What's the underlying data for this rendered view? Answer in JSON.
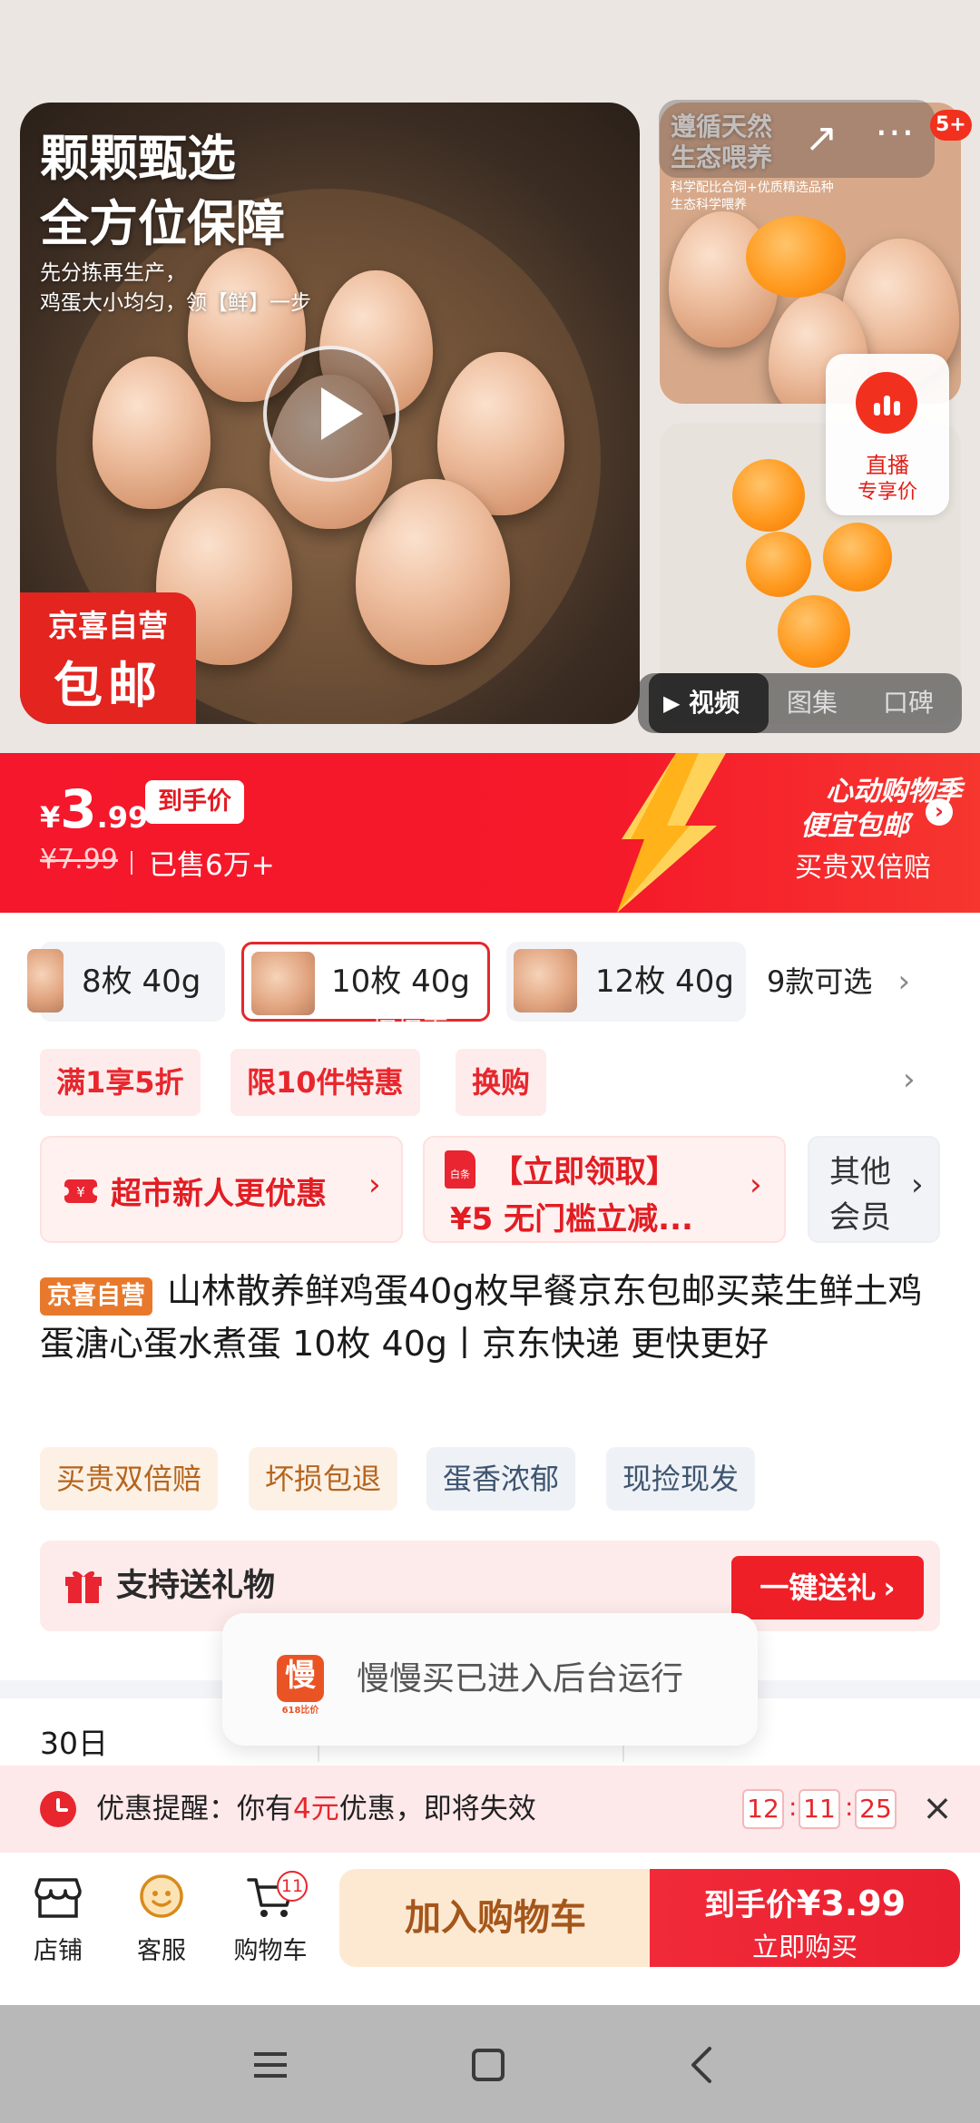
{
  "gallery": {
    "main_title": "颗颗甄选\n全方位保障",
    "main_subtitle": "先分拣再生产，\n鸡蛋大小均匀，领【鲜】一步",
    "badge_line1": "京喜自营",
    "badge_line2": "包邮",
    "side1_title": "遵循天然\n生态喂养",
    "side1_sub": "科学配比合饲+优质精选品种\n生态科学喂养",
    "message_badge": "5+",
    "live_label": "直播",
    "live_sub": "专享价",
    "tabs": [
      {
        "label": "视频",
        "active": true
      },
      {
        "label": "图集",
        "active": false
      },
      {
        "label": "口碑",
        "active": false
      }
    ]
  },
  "price": {
    "currency": "¥",
    "integer": "3",
    "decimal": ".99",
    "tag": "到手价",
    "original": "¥7.99",
    "sold": "已售6万+",
    "promo_line1": "心动购物季",
    "promo_line2": "便宜包邮",
    "promo_line3": "买贵双倍赔",
    "accent_color": "#f5172b"
  },
  "variants": {
    "items": [
      {
        "label": "8枚 40g",
        "selected": false
      },
      {
        "label": "10枚 40g",
        "selected": true
      },
      {
        "label": "12枚 40g",
        "selected": false
      }
    ],
    "count_label": "9款可选",
    "watermark": "慢慢买"
  },
  "coupons": [
    "满1享5折",
    "限10件特惠",
    "换购"
  ],
  "benefits": {
    "new_user": "超市新人更优惠",
    "coupon_icon": "白条",
    "coupon_line1": "【立即领取】",
    "coupon_line2": "¥5 无门槛立减...",
    "member_line1": "其他",
    "member_line2": "会员"
  },
  "product": {
    "tag": "京喜自营",
    "title": "山林散养鲜鸡蛋40g枚早餐京东包邮买菜生鲜土鸡蛋溏心蛋水煮蛋 10枚 40g丨京东快递 更快更好",
    "services": [
      {
        "label": "买贵双倍赔",
        "style": "warm"
      },
      {
        "label": "坏损包退",
        "style": "warm"
      },
      {
        "label": "蛋香浓郁",
        "style": "cool"
      },
      {
        "label": "现捡现发",
        "style": "cool"
      }
    ]
  },
  "gift": {
    "label": "支持送礼物",
    "button": "一键送礼"
  },
  "toast": {
    "icon_char": "慢",
    "icon_sub": "618比价",
    "message": "慢慢买已进入后台运行"
  },
  "params": {
    "first": "30日"
  },
  "reminder": {
    "prefix": "优惠提醒：你有",
    "amount": "4元",
    "suffix": "优惠，即将失效",
    "hours": "12",
    "minutes": "11",
    "seconds": "25"
  },
  "actionbar": {
    "store": "店铺",
    "service": "客服",
    "cart": "购物车",
    "cart_count": "11",
    "add_to_cart": "加入购物车",
    "buy_price_label": "到手价",
    "buy_price": "¥3.99",
    "buy_now": "立即购买"
  }
}
